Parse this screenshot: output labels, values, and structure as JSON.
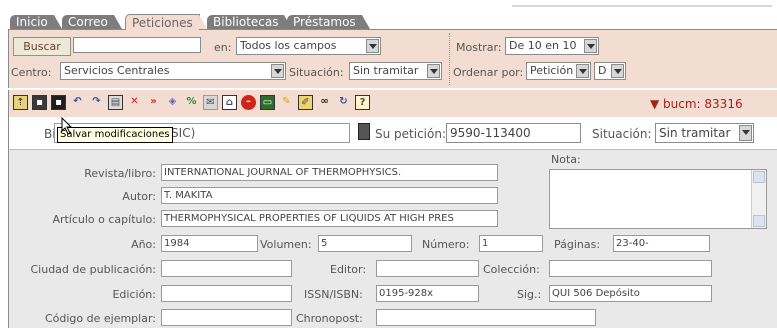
{
  "tabs": [
    {
      "label": "Inicio",
      "active": false
    },
    {
      "label": "Correo",
      "active": false
    },
    {
      "label": "Peticiones",
      "active": true
    },
    {
      "label": "Bibliotecas",
      "active": false
    },
    {
      "label": "Préstamos",
      "active": false
    }
  ],
  "search": {
    "button_label": "Buscar",
    "query_value": "",
    "en_label": "en:",
    "field_selected": "Todos los campos",
    "mostrar_label": "Mostrar:",
    "mostrar_selected": "De 10 en 10",
    "centro_label": "Centro:",
    "centro_selected": "Servicios Centrales",
    "situacion_label": "Situación:",
    "situacion_selected": "Sin tramitar",
    "ordenar_label": "Ordenar por:",
    "ordenar_selected": "Petición",
    "orden_dir_selected": "D"
  },
  "toolbar": {
    "icons": [
      "folder-up-icon",
      "save-icon",
      "save-as-icon",
      "reply-icon",
      "forward-icon",
      "print-icon",
      "delete-x-icon",
      "fast-forward-icon",
      "tag-icon",
      "percent-icon",
      "mail-icon",
      "envelope-icon",
      "stop-icon",
      "screen-icon",
      "pencil-icon",
      "edit-form-icon",
      "binoculars-icon",
      "refresh-icon",
      "help-icon"
    ],
    "bucm_label": "▼ bucm: 83316"
  },
  "record": {
    "tooltip": "Salvar modificaciones",
    "biblio_prefix": "Bi",
    "biblio_value": "(CSIC)",
    "su_peticion_label": "Su petición:",
    "su_peticion_value": "9590-113400",
    "situacion_label": "Situación:",
    "situacion_value": "Sin tramitar"
  },
  "form": {
    "revista_label": "Revista/libro:",
    "revista_value": "INTERNATIONAL JOURNAL OF THERMOPHYSICS.",
    "nota_label": "Nota:",
    "autor_label": "Autor:",
    "autor_value": "T. MAKITA",
    "articulo_label": "Artículo o capítulo:",
    "articulo_value": "THERMOPHYSICAL PROPERTIES OF LIQUIDS AT HIGH PRES",
    "anio_label": "Año:",
    "anio_value": "1984",
    "volumen_label": "Volumen:",
    "volumen_value": "5",
    "numero_label": "Número:",
    "numero_value": "1",
    "paginas_label": "Páginas:",
    "paginas_value": "23-40-",
    "ciudad_label": "Ciudad de publicación:",
    "ciudad_value": "",
    "editor_label": "Editor:",
    "editor_value": "",
    "coleccion_label": "Colección:",
    "coleccion_value": "",
    "edicion_label": "Edición:",
    "edicion_value": "",
    "issn_label": "ISSN/ISBN:",
    "issn_value": "0195-928x",
    "sig_label": "Sig.:",
    "sig_value": "QUI 506 Depósito",
    "codigo_label": "Código de ejemplar:",
    "codigo_value": "",
    "chronopost_label": "Chronopost:",
    "chronopost_value": ""
  }
}
